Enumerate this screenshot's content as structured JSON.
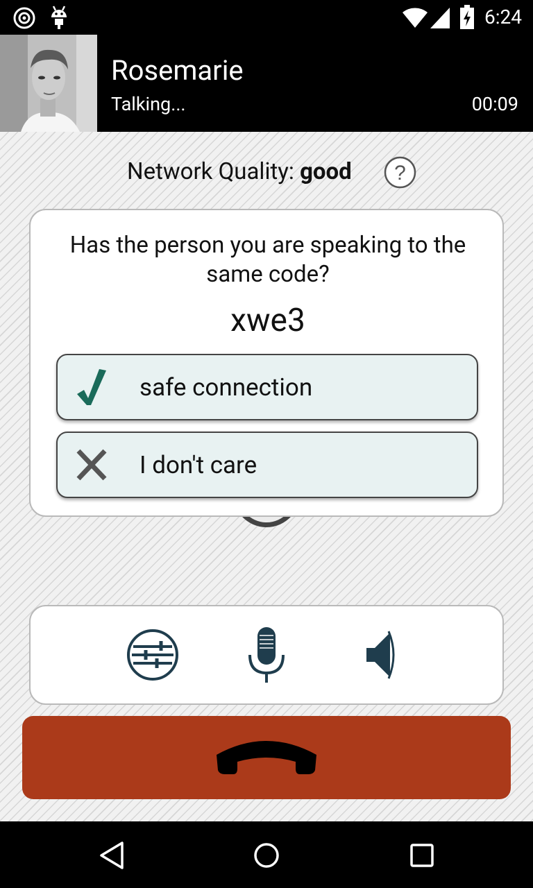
{
  "status_bar": {
    "time": "6:24",
    "icons": [
      "notification-icon",
      "android-icon",
      "wifi-icon",
      "signal-icon",
      "battery-charging-icon"
    ]
  },
  "call": {
    "contact_name": "Rosemarie",
    "status": "Talking...",
    "timer": "00:09"
  },
  "network": {
    "label": "Network Quality:",
    "quality": "good"
  },
  "verify": {
    "question": "Has the person you are speaking to the same code?",
    "code": "xwe3",
    "confirm_label": "safe connection",
    "dismiss_label": "I don't care"
  },
  "controls": [
    "settings-icon",
    "microphone-icon",
    "speaker-icon"
  ],
  "colors": {
    "accent": "#1a6b5a",
    "hangup": "#ab3a1a",
    "icon": "#1f3d4d",
    "choice_bg": "#e8f2f2"
  },
  "nav": [
    "back",
    "home",
    "recents"
  ]
}
